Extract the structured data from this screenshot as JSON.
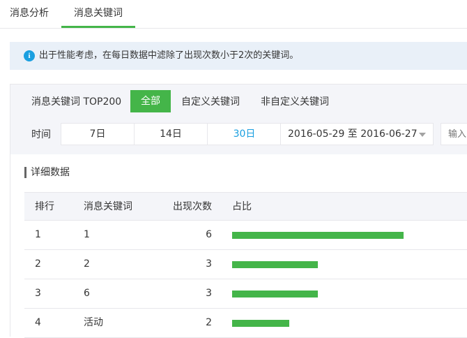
{
  "top_tabs": [
    {
      "label": "消息分析"
    },
    {
      "label": "消息关键词"
    }
  ],
  "notice": {
    "icon": "info-icon",
    "text": "出于性能考虑，在每日数据中滤除了出现次数小于2次的关键词。"
  },
  "sub_tabs": [
    {
      "label": "消息关键词 TOP200"
    },
    {
      "label": "全部"
    },
    {
      "label": "自定义关键词"
    },
    {
      "label": "非自定义关键词"
    }
  ],
  "filter": {
    "time_label": "时间",
    "ranges": [
      "7日",
      "14日",
      "30日"
    ],
    "selected_range": "30日",
    "date_range": "2016-05-29 至 2016-06-27",
    "search_placeholder": "输入"
  },
  "section_title": "详细数据",
  "table": {
    "headers": [
      "排行",
      "消息关键词",
      "出现次数",
      "占比"
    ],
    "rows": [
      {
        "rank": "1",
        "keyword": "1",
        "count": "6",
        "share": 1.0
      },
      {
        "rank": "2",
        "keyword": "2",
        "count": "3",
        "share": 0.5
      },
      {
        "rank": "3",
        "keyword": "6",
        "count": "3",
        "share": 0.5
      },
      {
        "rank": "4",
        "keyword": "活动",
        "count": "2",
        "share": 0.3333
      }
    ]
  },
  "colors": {
    "accent": "#44b549",
    "link": "#1a9fe0",
    "notice_bg": "#e9f0f8"
  }
}
